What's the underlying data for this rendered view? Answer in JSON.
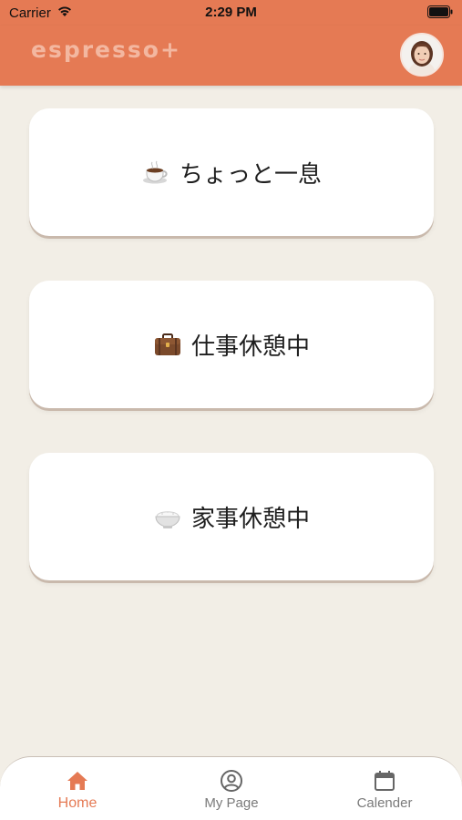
{
  "status_bar": {
    "carrier": "Carrier",
    "time": "2:29 PM"
  },
  "header": {
    "logo": "espresso+"
  },
  "cards": [
    {
      "icon": "coffee-cup-icon",
      "label": "ちょっと一息"
    },
    {
      "icon": "briefcase-icon",
      "label": "仕事休憩中"
    },
    {
      "icon": "rice-bowl-icon",
      "label": "家事休憩中"
    }
  ],
  "tabs": [
    {
      "icon": "home-icon",
      "label": "Home",
      "active": true
    },
    {
      "icon": "user-circle-icon",
      "label": "My Page",
      "active": false
    },
    {
      "icon": "calendar-icon",
      "label": "Calender",
      "active": false
    }
  ],
  "colors": {
    "accent": "#e57a54",
    "background": "#f2eee6",
    "card": "#ffffff",
    "inactive_tab": "#7a7a7a"
  }
}
